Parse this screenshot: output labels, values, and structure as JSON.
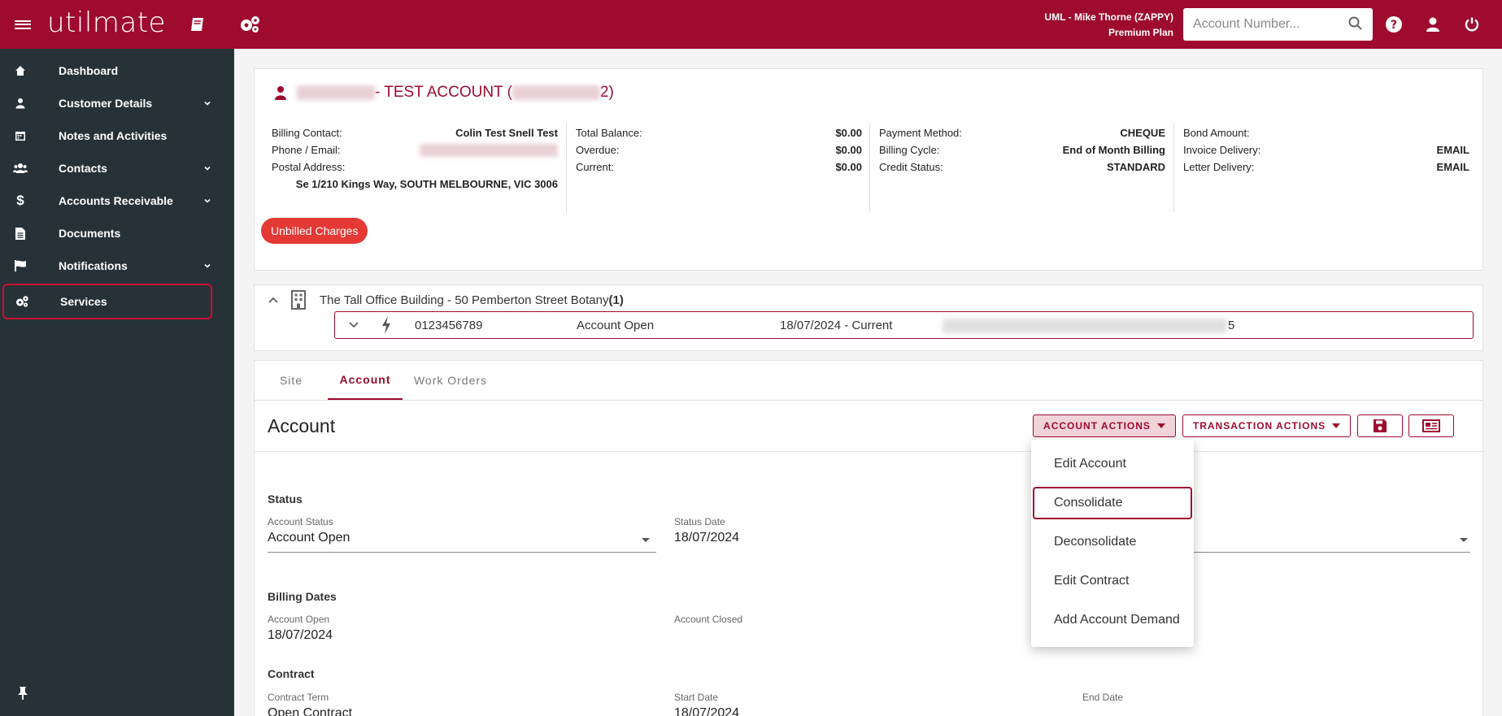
{
  "topbar": {
    "logo": "utilmate",
    "user_line": "UML - Mike Thorne (ZAPPY)",
    "plan_line": "Premium Plan",
    "search_placeholder": "Account Number..."
  },
  "sidebar": {
    "items": [
      {
        "label": "Dashboard",
        "icon": "home-icon",
        "expandable": false
      },
      {
        "label": "Customer Details",
        "icon": "user-icon",
        "expandable": true
      },
      {
        "label": "Notes and Activities",
        "icon": "calendar-icon",
        "expandable": false
      },
      {
        "label": "Contacts",
        "icon": "users-icon",
        "expandable": true
      },
      {
        "label": "Accounts Receivable",
        "icon": "dollar-icon",
        "expandable": true
      },
      {
        "label": "Documents",
        "icon": "file-icon",
        "expandable": false
      },
      {
        "label": "Notifications",
        "icon": "flag-icon",
        "expandable": true
      },
      {
        "label": "Services",
        "icon": "cogs-icon",
        "expandable": false,
        "active": true
      }
    ]
  },
  "account_header": {
    "title_mid": " - TEST ACCOUNT (",
    "title_tail": "2)",
    "col1": {
      "billing_contact_label": "Billing Contact:",
      "billing_contact_value": "Colin Test Snell Test",
      "phone_email_label": "Phone / Email:",
      "postal_address_label": "Postal Address:",
      "postal_address_value": "Se 1/210 Kings Way, SOUTH MELBOURNE, VIC 3006"
    },
    "col2": [
      {
        "label": "Total Balance:",
        "value": "$0.00"
      },
      {
        "label": "Overdue:",
        "value": "$0.00"
      },
      {
        "label": "Current:",
        "value": "$0.00"
      }
    ],
    "col3": [
      {
        "label": "Payment Method:",
        "value": "CHEQUE"
      },
      {
        "label": "Billing Cycle:",
        "value": "End of Month Billing"
      },
      {
        "label": "Credit Status:",
        "value": "STANDARD"
      }
    ],
    "col4": [
      {
        "label": "Bond Amount:",
        "value": ""
      },
      {
        "label": "Invoice Delivery:",
        "value": "EMAIL"
      },
      {
        "label": "Letter Delivery:",
        "value": "EMAIL"
      }
    ],
    "unbilled_label": "Unbilled Charges"
  },
  "site": {
    "address": "The Tall Office Building - 50 Pemberton Street Botany ",
    "count": "(1)",
    "service": {
      "number": "0123456789",
      "status": "Account Open",
      "period": "18/07/2024 - Current",
      "tail": "5"
    }
  },
  "tabs": [
    "Site",
    "Account",
    "Work Orders"
  ],
  "account_form": {
    "title": "Account",
    "account_actions_label": "ACCOUNT ACTIONS",
    "transaction_actions_label": "TRANSACTION ACTIONS",
    "status_section": "Status",
    "account_status_label": "Account Status",
    "account_status_value": "Account Open",
    "status_date_label": "Status Date",
    "status_date_value": "18/07/2024",
    "billing_dates_section": "Billing Dates",
    "account_open_label": "Account Open",
    "account_open_value": "18/07/2024",
    "account_closed_label": "Account Closed",
    "contract_section": "Contract",
    "contract_term_label": "Contract Term",
    "contract_term_value": "Open Contract",
    "start_date_label": "Start Date",
    "start_date_value": "18/07/2024",
    "end_date_label": "End Date"
  },
  "actions_menu": {
    "items": [
      "Edit Account",
      "Consolidate",
      "Deconsolidate",
      "Edit Contract",
      "Add Account Demand"
    ],
    "highlighted": "Consolidate"
  },
  "colors": {
    "brand": "#9e0b2e",
    "sidebar": "#263238",
    "unbilled": "#e53935"
  }
}
